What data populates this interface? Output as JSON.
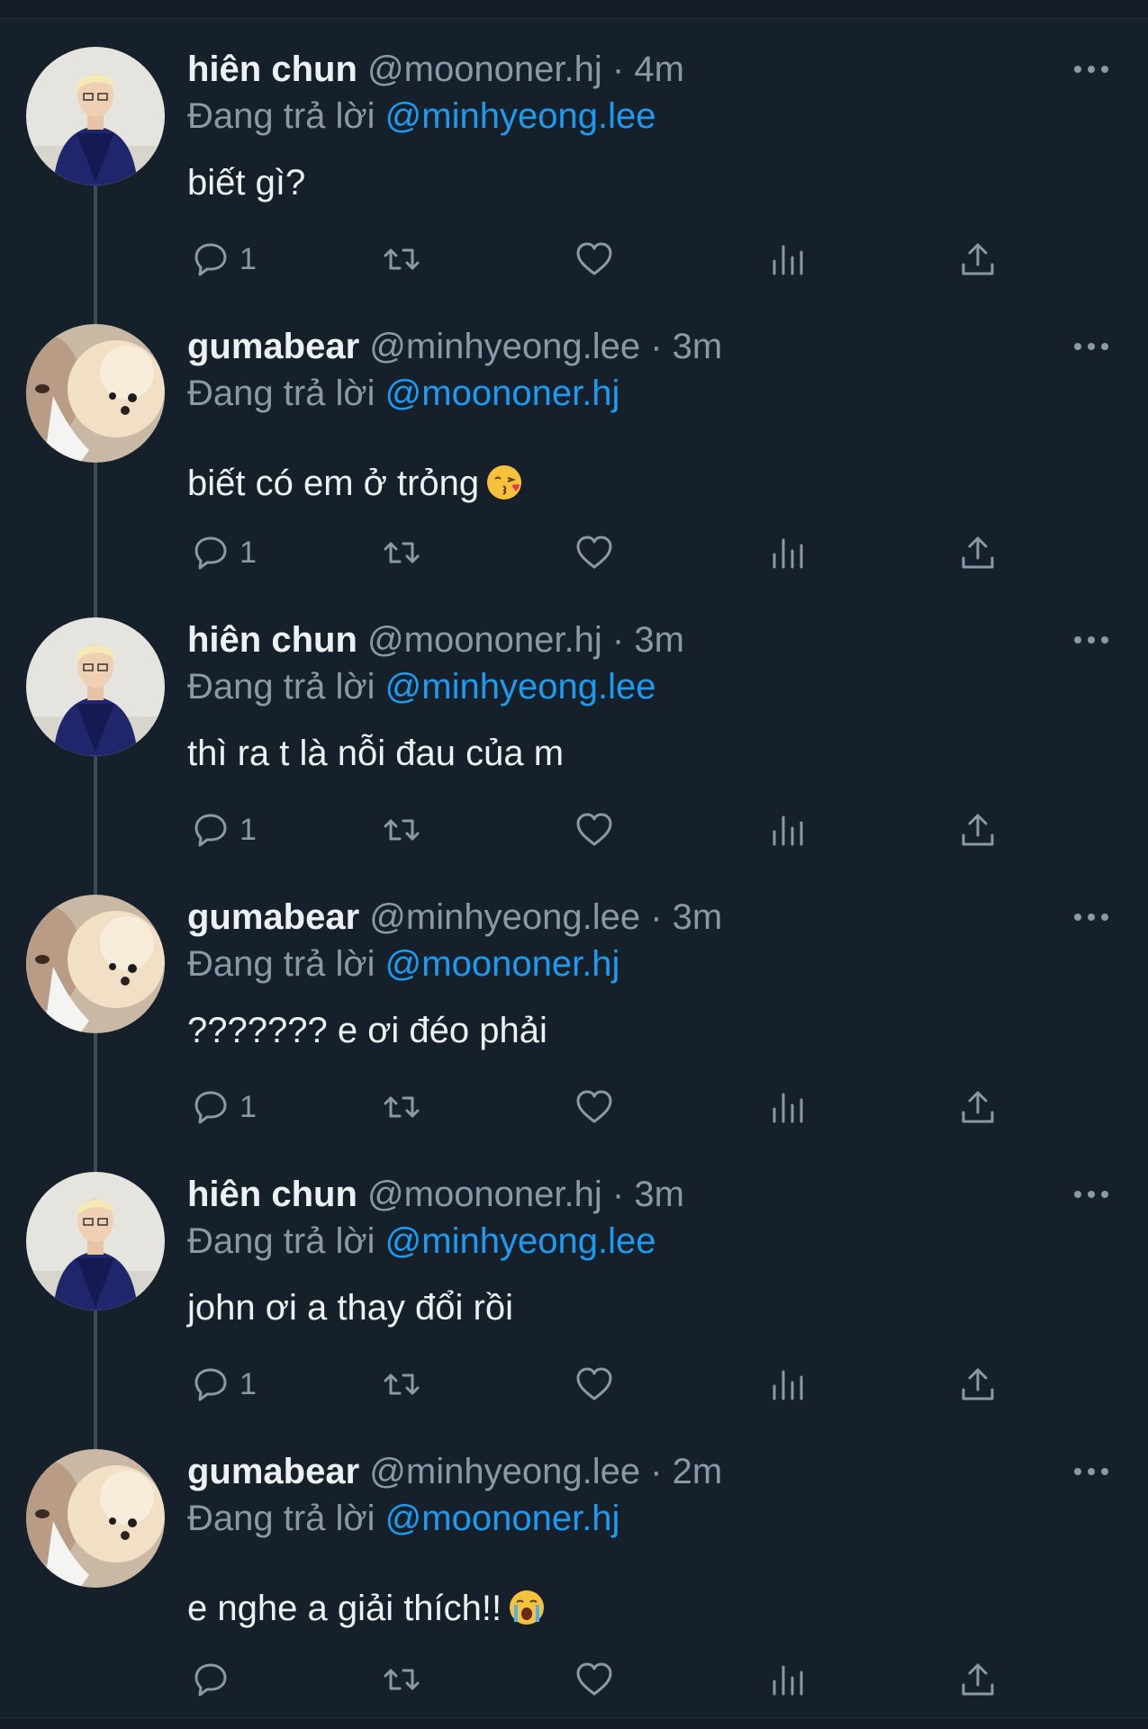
{
  "tweets": [
    {
      "name": "hiên chun",
      "handle": "@moononer.hj",
      "time": "4m",
      "reply_prefix": "Đang trả lời",
      "reply_to": "@minhyeong.lee",
      "text": "biết gì?",
      "emoji": "",
      "reply_count": "1",
      "avatar": "boy-avatar"
    },
    {
      "name": "gumabear",
      "handle": "@minhyeong.lee",
      "time": "3m",
      "reply_prefix": "Đang trả lời",
      "reply_to": "@moononer.hj",
      "text": "biết có em ở trỏng",
      "emoji": "kiss-face",
      "reply_count": "1",
      "avatar": "dog-avatar"
    },
    {
      "name": "hiên chun",
      "handle": "@moononer.hj",
      "time": "3m",
      "reply_prefix": "Đang trả lời",
      "reply_to": "@minhyeong.lee",
      "text": "thì ra t là nỗi đau của m",
      "emoji": "",
      "reply_count": "1",
      "avatar": "boy-avatar"
    },
    {
      "name": "gumabear",
      "handle": "@minhyeong.lee",
      "time": "3m",
      "reply_prefix": "Đang trả lời",
      "reply_to": "@moononer.hj",
      "text": "??????? e ơi đéo phải",
      "emoji": "",
      "reply_count": "1",
      "avatar": "dog-avatar"
    },
    {
      "name": "hiên chun",
      "handle": "@moononer.hj",
      "time": "3m",
      "reply_prefix": "Đang trả lời",
      "reply_to": "@minhyeong.lee",
      "text": "john ơi a thay đổi rồi",
      "emoji": "",
      "reply_count": "1",
      "avatar": "boy-avatar"
    },
    {
      "name": "gumabear",
      "handle": "@minhyeong.lee",
      "time": "2m",
      "reply_prefix": "Đang trả lời",
      "reply_to": "@moononer.hj",
      "text": "e nghe a giải thích!!",
      "emoji": "crying-face",
      "reply_count": "",
      "avatar": "dog-avatar"
    }
  ],
  "dot": "·",
  "icons": [
    "reply-icon",
    "retweet-icon",
    "like-icon",
    "analytics-icon",
    "share-icon",
    "more-icon"
  ],
  "colors": {
    "background": "#15202b",
    "accent": "#1d9bf0",
    "muted": "#8b98a5",
    "text": "#eef1f3"
  }
}
